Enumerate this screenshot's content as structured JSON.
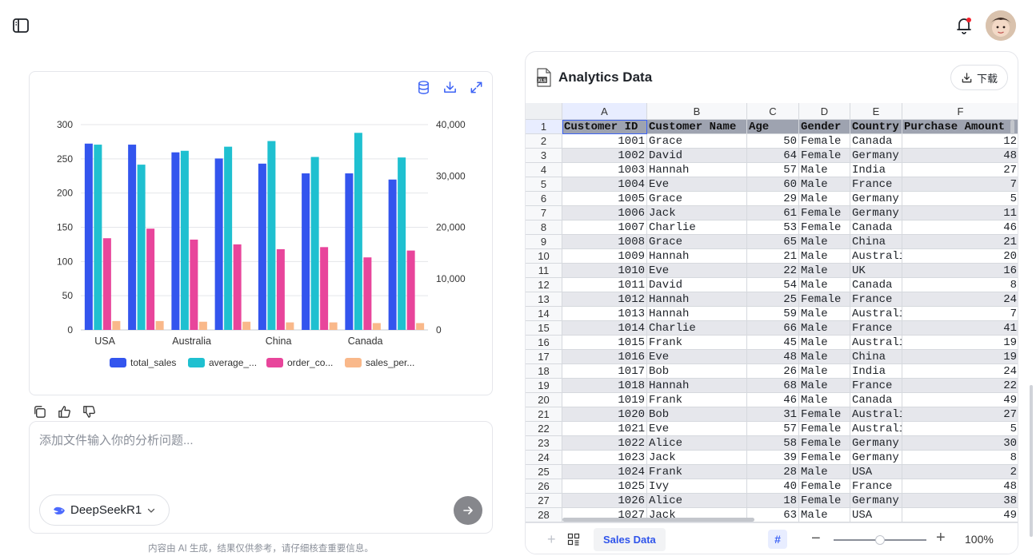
{
  "header": {
    "sidebar_toggle_icon": "sidebar-toggle-icon",
    "notification_icon": "bell-icon",
    "avatar_icon": "user-avatar"
  },
  "chart_card": {
    "tool_icons": [
      "database-icon",
      "download-icon",
      "expand-icon"
    ]
  },
  "chart_data": {
    "type": "bar",
    "categories": [
      "USA",
      "Australia",
      "China",
      "Canada"
    ],
    "x_tick_labels": [
      "USA",
      "Australia",
      "China",
      "Canada"
    ],
    "bar_groups": 8,
    "left_axis": {
      "ticks": [
        "300",
        "250",
        "200",
        "150",
        "100",
        "50",
        "0"
      ],
      "ylim": [
        0,
        300
      ]
    },
    "right_axis": {
      "ticks": [
        "40,000",
        "30,000",
        "20,000",
        "10,000",
        "0"
      ],
      "ylim": [
        0,
        40000
      ]
    },
    "grid": true,
    "legend_position": "bottom",
    "series": [
      {
        "name": "total_sales",
        "axis": "right",
        "color": "#3355ee",
        "values": [
          36300,
          36100,
          34600,
          33400,
          32400,
          30500,
          30500,
          29300
        ]
      },
      {
        "name": "average_...",
        "axis": "right",
        "color": "#1fc0d0",
        "values": [
          36100,
          32200,
          34900,
          35700,
          36800,
          33700,
          38400,
          33600
        ]
      },
      {
        "name": "order_co...",
        "axis": "left",
        "color": "#e8459b",
        "values": [
          134,
          148,
          132,
          125,
          118,
          121,
          106,
          116
        ]
      },
      {
        "name": "sales_per...",
        "axis": "left",
        "color": "#f9b88a",
        "values": [
          13,
          13,
          12,
          12,
          11,
          11,
          10,
          10
        ]
      }
    ]
  },
  "feedback": {
    "icons": [
      "copy-icon",
      "thumbs-up-icon",
      "thumbs-down-icon"
    ]
  },
  "input": {
    "placeholder": "添加文件输入你的分析问题...",
    "model_label": "DeepSeekR1",
    "send_icon": "arrow-right-icon"
  },
  "disclaimer": "内容由 AI 生成，结果仅供参考，请仔细核查重要信息。",
  "panel": {
    "title": "Analytics Data",
    "download_label": "下载"
  },
  "sheet": {
    "columns": [
      "A",
      "B",
      "C",
      "D",
      "E",
      "F"
    ],
    "header_row": [
      "Customer ID",
      "Customer Name",
      "Age",
      "Gender",
      "Country",
      "Purchase Amount"
    ],
    "rows": [
      [
        "1001",
        "Grace",
        "50",
        "Female",
        "Canada",
        "12"
      ],
      [
        "1002",
        "David",
        "64",
        "Female",
        "Germany",
        "48"
      ],
      [
        "1003",
        "Hannah",
        "57",
        "Male",
        "India",
        "27"
      ],
      [
        "1004",
        "Eve",
        "60",
        "Male",
        "France",
        "7"
      ],
      [
        "1005",
        "Grace",
        "29",
        "Male",
        "Germany",
        "5"
      ],
      [
        "1006",
        "Jack",
        "61",
        "Female",
        "Germany",
        "11"
      ],
      [
        "1007",
        "Charlie",
        "53",
        "Female",
        "Canada",
        "46"
      ],
      [
        "1008",
        "Grace",
        "65",
        "Male",
        "China",
        "21"
      ],
      [
        "1009",
        "Hannah",
        "21",
        "Male",
        "Australi",
        "20"
      ],
      [
        "1010",
        "Eve",
        "22",
        "Male",
        "UK",
        "16"
      ],
      [
        "1011",
        "David",
        "54",
        "Male",
        "Canada",
        "8"
      ],
      [
        "1012",
        "Hannah",
        "25",
        "Female",
        "France",
        "24"
      ],
      [
        "1013",
        "Hannah",
        "59",
        "Male",
        "Australi",
        "7"
      ],
      [
        "1014",
        "Charlie",
        "66",
        "Male",
        "France",
        "41"
      ],
      [
        "1015",
        "Frank",
        "45",
        "Male",
        "Australi",
        "19"
      ],
      [
        "1016",
        "Eve",
        "48",
        "Male",
        "China",
        "19"
      ],
      [
        "1017",
        "Bob",
        "26",
        "Male",
        "India",
        "24"
      ],
      [
        "1018",
        "Hannah",
        "68",
        "Male",
        "France",
        "22"
      ],
      [
        "1019",
        "Frank",
        "46",
        "Male",
        "Canada",
        "49"
      ],
      [
        "1020",
        "Bob",
        "31",
        "Female",
        "Australi",
        "27"
      ],
      [
        "1021",
        "Eve",
        "57",
        "Female",
        "Australi",
        "5"
      ],
      [
        "1022",
        "Alice",
        "58",
        "Female",
        "Germany",
        "30"
      ],
      [
        "1023",
        "Jack",
        "39",
        "Female",
        "Germany",
        "8"
      ],
      [
        "1024",
        "Frank",
        "28",
        "Male",
        "USA",
        "2"
      ],
      [
        "1025",
        "Ivy",
        "40",
        "Female",
        "France",
        "48"
      ],
      [
        "1026",
        "Alice",
        "18",
        "Female",
        "Germany",
        "38"
      ],
      [
        "1027",
        "Jack",
        "63",
        "Male",
        "USA",
        "49"
      ]
    ],
    "tab_label": "Sales Data",
    "grid_toggle": "#",
    "zoom_level": "100%",
    "zoom_fraction": 0.5
  }
}
